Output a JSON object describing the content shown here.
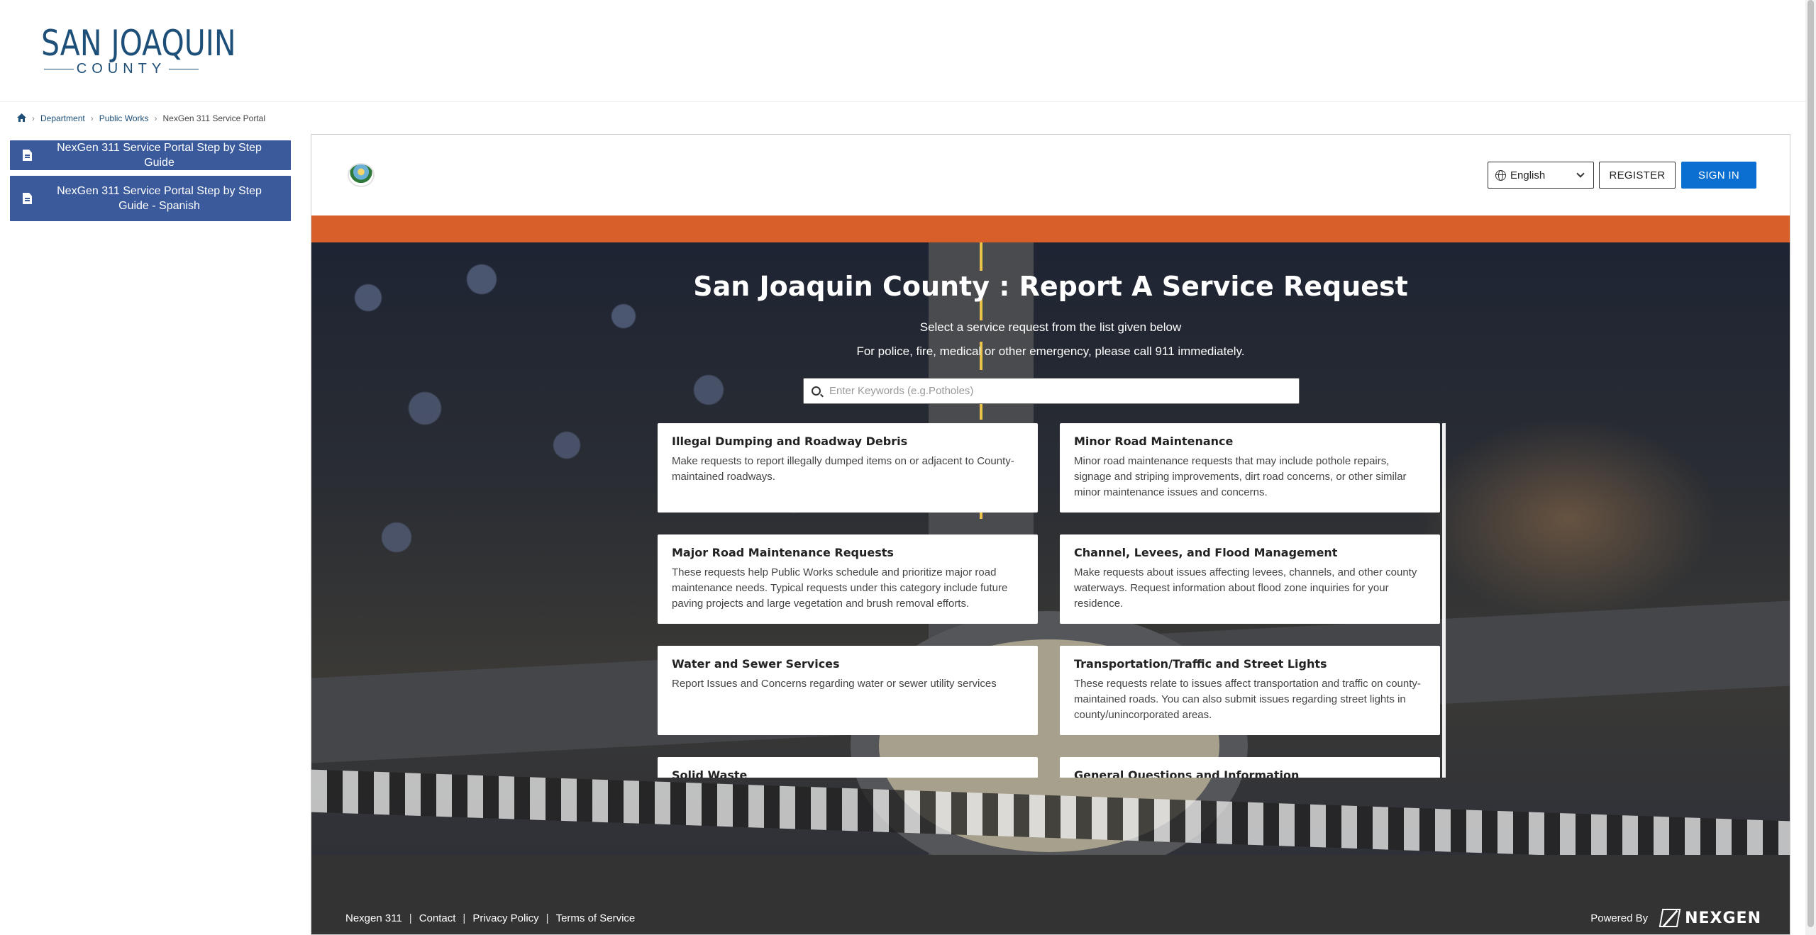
{
  "site": {
    "logo_top": "SAN JOAQUIN",
    "logo_bottom": "COUNTY"
  },
  "breadcrumb": {
    "home_icon": "home-icon",
    "items": [
      "Department",
      "Public Works",
      "NexGen 311 Service Portal"
    ]
  },
  "sidebar": {
    "items": [
      {
        "label": "NexGen 311 Service Portal Step by Step Guide",
        "icon": "document-icon"
      },
      {
        "label": "NexGen 311 Service Portal Step by Step Guide - Spanish",
        "icon": "document-icon"
      }
    ]
  },
  "portal": {
    "language": "English",
    "register_label": "REGISTER",
    "signin_label": "SIGN IN",
    "accent_color": "#d95f2a",
    "signin_color": "#0a6fd0"
  },
  "hero": {
    "title": "San Joaquin County : Report A Service Request",
    "subtitle": "Select a service request from the list given below",
    "emergency_note": "For police, fire, medical or other emergency, please call 911 immediately.",
    "search_placeholder": "Enter Keywords (e.g.Potholes)"
  },
  "categories": [
    {
      "title": "Illegal Dumping and Roadway Debris",
      "description": "Make requests to report illegally dumped items on or adjacent to County-maintained roadways."
    },
    {
      "title": "Minor Road Maintenance",
      "description": "Minor road maintenance requests that may include pothole repairs, signage and striping improvements, dirt road concerns, or other similar minor maintenance issues and concerns."
    },
    {
      "title": "Major Road Maintenance Requests",
      "description": "These requests help Public Works schedule and prioritize major road maintenance needs. Typical requests under this category include future paving projects and large vegetation and brush removal efforts."
    },
    {
      "title": "Channel, Levees, and Flood Management",
      "description": "Make requests about issues affecting levees, channels, and other county waterways. Request information about flood zone inquiries for your residence."
    },
    {
      "title": "Water and Sewer Services",
      "description": "Report Issues and Concerns regarding water or sewer utility services"
    },
    {
      "title": "Transportation/Traffic and Street Lights",
      "description": "These requests relate to issues affect transportation and traffic on county-maintained roads. You can also submit issues regarding street lights in county/unincorporated areas."
    },
    {
      "title": "Solid Waste",
      "description": ""
    },
    {
      "title": "General Questions and Information",
      "description": ""
    }
  ],
  "footer": {
    "links": [
      "Nexgen 311",
      "Contact",
      "Privacy Policy",
      "Terms of Service"
    ],
    "powered_by": "Powered By",
    "brand": "NEXGEN"
  }
}
